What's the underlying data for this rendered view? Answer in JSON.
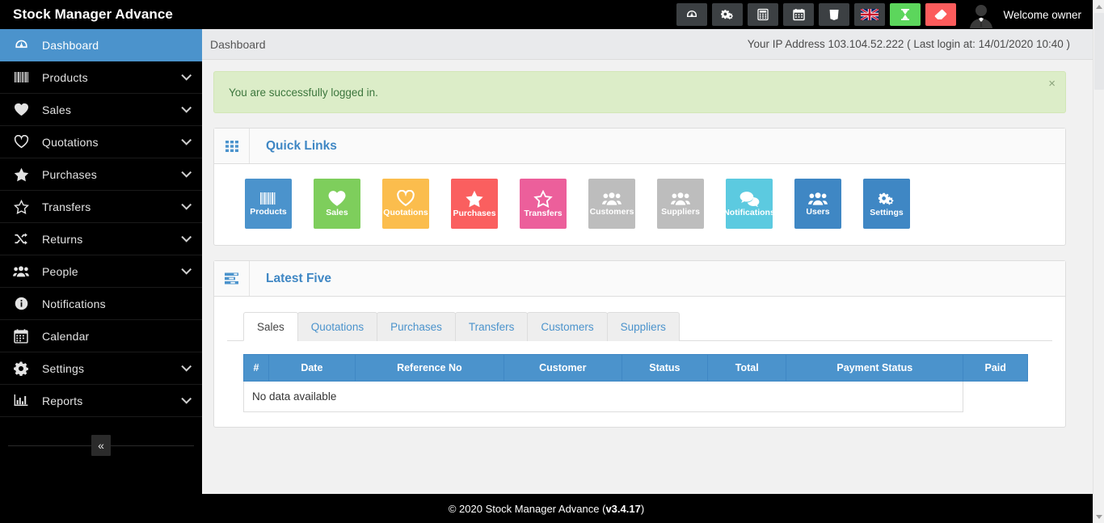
{
  "app": {
    "brand": "Stock Manager Advance",
    "welcome": "Welcome owner",
    "avatar_icon": "user-avatar-icon"
  },
  "navbar": {
    "buttons": [
      {
        "name": "dashboard-icon",
        "title": "Dashboard",
        "style": "dark"
      },
      {
        "name": "cogs-icon",
        "title": "Settings",
        "style": "dark"
      },
      {
        "name": "calculator-icon",
        "title": "Calculator",
        "style": "dark"
      },
      {
        "name": "calendar-icon",
        "title": "Calendar",
        "style": "dark"
      },
      {
        "name": "css3-icon",
        "title": "CSS3",
        "style": "dark"
      },
      {
        "name": "flag-uk-icon",
        "title": "English",
        "style": "dark"
      },
      {
        "name": "hourglass-icon",
        "title": "Hourglass",
        "style": "green"
      },
      {
        "name": "eraser-icon",
        "title": "Clear Cache",
        "style": "red"
      }
    ]
  },
  "sidebar": {
    "items": [
      {
        "label": "Dashboard",
        "icon": "dashboard-icon",
        "active": true,
        "caret": false
      },
      {
        "label": "Products",
        "icon": "barcode-icon",
        "active": false,
        "caret": true
      },
      {
        "label": "Sales",
        "icon": "heart-filled-icon",
        "active": false,
        "caret": true
      },
      {
        "label": "Quotations",
        "icon": "heart-outline-icon",
        "active": false,
        "caret": true
      },
      {
        "label": "Purchases",
        "icon": "star-filled-icon",
        "active": false,
        "caret": true
      },
      {
        "label": "Transfers",
        "icon": "star-outline-icon",
        "active": false,
        "caret": true
      },
      {
        "label": "Returns",
        "icon": "shuffle-icon",
        "active": false,
        "caret": true
      },
      {
        "label": "People",
        "icon": "users-icon",
        "active": false,
        "caret": true
      },
      {
        "label": "Notifications",
        "icon": "info-circle-icon",
        "active": false,
        "caret": false
      },
      {
        "label": "Calendar",
        "icon": "calendar-icon",
        "active": false,
        "caret": false
      },
      {
        "label": "Settings",
        "icon": "gear-icon",
        "active": false,
        "caret": true
      },
      {
        "label": "Reports",
        "icon": "bar-chart-icon",
        "active": false,
        "caret": true
      }
    ],
    "collapse_label": "«"
  },
  "subheader": {
    "breadcrumb": "Dashboard",
    "ip_info": "Your IP Address 103.104.52.222 ( Last login at: 14/01/2020 10:40 )"
  },
  "alert": {
    "message": "You are successfully logged in.",
    "close_label": "×"
  },
  "quick_links": {
    "title": "Quick Links",
    "panel_icon": "grid-icon",
    "tiles": [
      {
        "label": "Products",
        "icon": "barcode-icon",
        "color": "#4b93cc"
      },
      {
        "label": "Sales",
        "icon": "heart-filled-icon",
        "color": "#7ece5c"
      },
      {
        "label": "Quotations",
        "icon": "heart-outline-icon",
        "color": "#fbbd4d"
      },
      {
        "label": "Purchases",
        "icon": "star-filled-icon",
        "color": "#fa5f5f"
      },
      {
        "label": "Transfers",
        "icon": "star-outline-icon",
        "color": "#ec5f9b"
      },
      {
        "label": "Customers",
        "icon": "users-icon",
        "color": "#bdbdbd"
      },
      {
        "label": "Suppliers",
        "icon": "users-icon",
        "color": "#bdbdbd"
      },
      {
        "label": "Notifications",
        "icon": "comments-icon",
        "color": "#5ccae0"
      },
      {
        "label": "Users",
        "icon": "users-icon",
        "color": "#3f87c4"
      },
      {
        "label": "Settings",
        "icon": "cogs-icon",
        "color": "#3f87c4"
      }
    ]
  },
  "latest_five": {
    "title": "Latest Five",
    "panel_icon": "list-icon",
    "tabs": [
      {
        "label": "Sales",
        "active": true
      },
      {
        "label": "Quotations",
        "active": false
      },
      {
        "label": "Purchases",
        "active": false
      },
      {
        "label": "Transfers",
        "active": false
      },
      {
        "label": "Customers",
        "active": false
      },
      {
        "label": "Suppliers",
        "active": false
      }
    ],
    "table": {
      "columns": [
        "#",
        "Date",
        "Reference No",
        "Customer",
        "Status",
        "Total",
        "Payment Status",
        "Paid"
      ],
      "rows": [],
      "empty_text": "No data available"
    }
  },
  "footer": {
    "copyright": "© 2020 Stock Manager Advance (",
    "version": "v3.4.17",
    "close_paren": " )"
  },
  "colors": {
    "accent_blue": "#4b93cc",
    "dark": "#000000",
    "alert_green_bg": "#dcedc8",
    "alert_green_text": "#3c763d"
  }
}
